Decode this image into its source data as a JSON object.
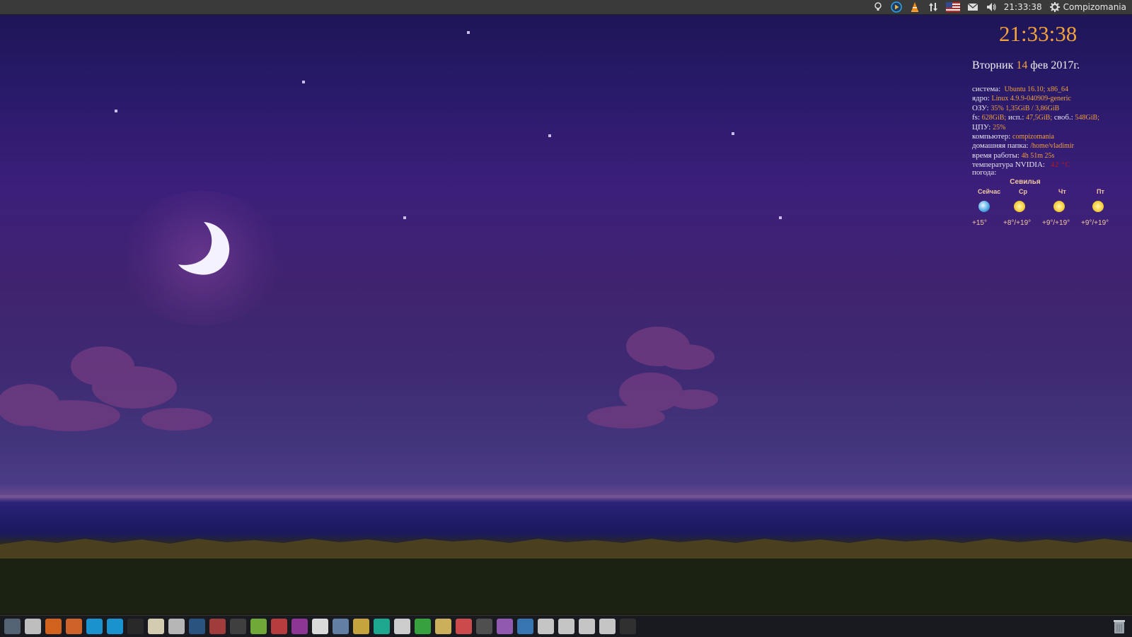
{
  "top_panel": {
    "clock": "21:33:38",
    "user": "Compizomania",
    "tray_icons": [
      "bulb-icon",
      "media-player-icon",
      "vlc-icon",
      "network-arrows-icon",
      "keyboard-layout-flag-icon",
      "mail-icon",
      "volume-icon",
      "settings-gear-icon"
    ]
  },
  "conky": {
    "clock": "21:33:38",
    "date": {
      "weekday": "Вторник",
      "day": "14",
      "rest": "фев 2017г."
    },
    "rows": [
      {
        "label": "система:",
        "value": "Ubuntu 16.10; x86_64"
      },
      {
        "label": "ядро:",
        "value": "Linux 4.9.9-040909-generic"
      },
      {
        "label": "ОЗУ:",
        "value": "35% 1,35GiB / 3,86GiB"
      },
      {
        "label": "fs:",
        "value": "628GiB;",
        "label2": "исп.:",
        "value2": "47,5GiB;",
        "label3": "своб.:",
        "value3": "548GiB;"
      },
      {
        "label": "ЦПУ:",
        "value": "25%"
      },
      {
        "label": "компьютер:",
        "value": "compizomania"
      },
      {
        "label": "домашняя папка:",
        "value": "/home/vladimir"
      },
      {
        "label": "время работы:",
        "value": "4h 51m 25s"
      },
      {
        "label": "температура NVIDIA:",
        "value": "42 °C"
      }
    ],
    "weather_label": "погода:",
    "weather": {
      "city": "Севилья",
      "days": [
        {
          "day": "Сейчас",
          "temp": "+15°",
          "icon": "moon-weather-icon"
        },
        {
          "day": "Ср",
          "temp": "+8°/+19°",
          "icon": "sun-weather-icon"
        },
        {
          "day": "Чт",
          "temp": "+9°/+19°",
          "icon": "sun-weather-icon"
        },
        {
          "day": "Пт",
          "temp": "+9°/+19°",
          "icon": "sun-weather-icon"
        }
      ]
    },
    "colors": {
      "accent": "#f4a23a",
      "warning": "#c01818"
    }
  },
  "dock": {
    "icons": [
      "ubuntu-icon",
      "files-icon",
      "firefox-icon",
      "software-center-icon",
      "skype-icon",
      "skype-alt-icon",
      "terminal-icon",
      "text-editor-icon",
      "screenshot-icon",
      "steam-icon",
      "settings-icon",
      "disk-icon",
      "gpu-icon",
      "search-app-icon",
      "transfer-icon",
      "cards-icon",
      "file-manager-icon",
      "folder-icon",
      "update-icon",
      "screen-icon",
      "sync-icon",
      "archive-icon",
      "media-icon",
      "drive-icon",
      "tweak-icon",
      "inkscape-icon",
      "drive-1-icon",
      "drive-2-icon",
      "drive-3-icon",
      "drive-4-icon",
      "phone-icon"
    ],
    "trash": "trash-icon"
  }
}
